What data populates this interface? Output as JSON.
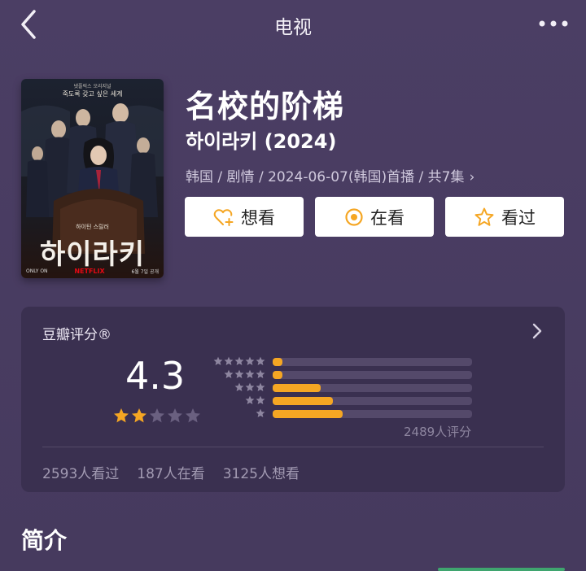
{
  "nav": {
    "title": "电视"
  },
  "poster": {
    "top_line1": "넷플릭스 오리지널",
    "top_line2": "죽도록 갖고 싶은 세계",
    "sub": "하이틴 스릴러",
    "main": "하이라키",
    "foot_left": "ONLY ON",
    "foot_brand": "NETFLIX",
    "foot_right": "6월 7일 공개"
  },
  "movie": {
    "title": "名校的阶梯",
    "original_title": "하이라키 (2024)",
    "meta": "韩国 / 剧情 / 2024-06-07(韩国)首播 / 共7集",
    "meta_chevron": "›"
  },
  "actions": {
    "want": "想看",
    "watching": "在看",
    "watched": "看过"
  },
  "rating": {
    "title": "豆瓣评分",
    "mark": "®",
    "score": "4.3",
    "stars_filled": 2,
    "stars_total": 5,
    "distribution": [
      {
        "stars": 5,
        "fraction": 0.05
      },
      {
        "stars": 4,
        "fraction": 0.05
      },
      {
        "stars": 3,
        "fraction": 0.24
      },
      {
        "stars": 2,
        "fraction": 0.3
      },
      {
        "stars": 1,
        "fraction": 0.35
      }
    ],
    "votes": "2489人评分",
    "stats": [
      "2593人看过",
      "187人在看",
      "3125人想看"
    ]
  },
  "intro": {
    "title": "简介"
  },
  "colors": {
    "accent": "#f5a623",
    "background": "#4a3d62",
    "card": "#3a3050"
  }
}
